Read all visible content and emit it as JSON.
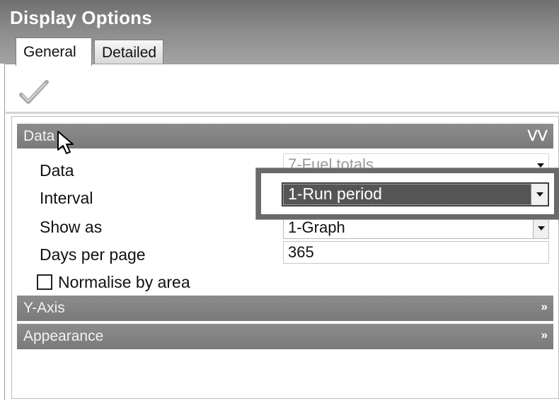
{
  "window": {
    "title": "Display Options"
  },
  "tabs": [
    {
      "label": "General",
      "active": true
    },
    {
      "label": "Detailed",
      "active": false
    }
  ],
  "toolbar": {
    "apply_icon": "checkmark-icon"
  },
  "sections": {
    "data": {
      "label": "Data",
      "expanded": true,
      "chevron": "»"
    },
    "yaxis": {
      "label": "Y-Axis",
      "expanded": false,
      "chevron": "»"
    },
    "appearance": {
      "label": "Appearance",
      "expanded": false,
      "chevron": "»"
    }
  },
  "fields": {
    "data": {
      "label": "Data",
      "value": "7-Fuel totals"
    },
    "interval": {
      "label": "Interval",
      "value": "1-Run period"
    },
    "show_as": {
      "label": "Show as",
      "value": "1-Graph"
    },
    "days_per_page": {
      "label": "Days per page",
      "value": "365"
    },
    "normalise": {
      "label": "Normalise by area",
      "checked": false
    }
  },
  "colors": {
    "header_gradient_top": "#6f6f6f",
    "section_bar": "#858585",
    "highlight_frame": "#6a6a6a",
    "selected_combo": "#555555"
  }
}
